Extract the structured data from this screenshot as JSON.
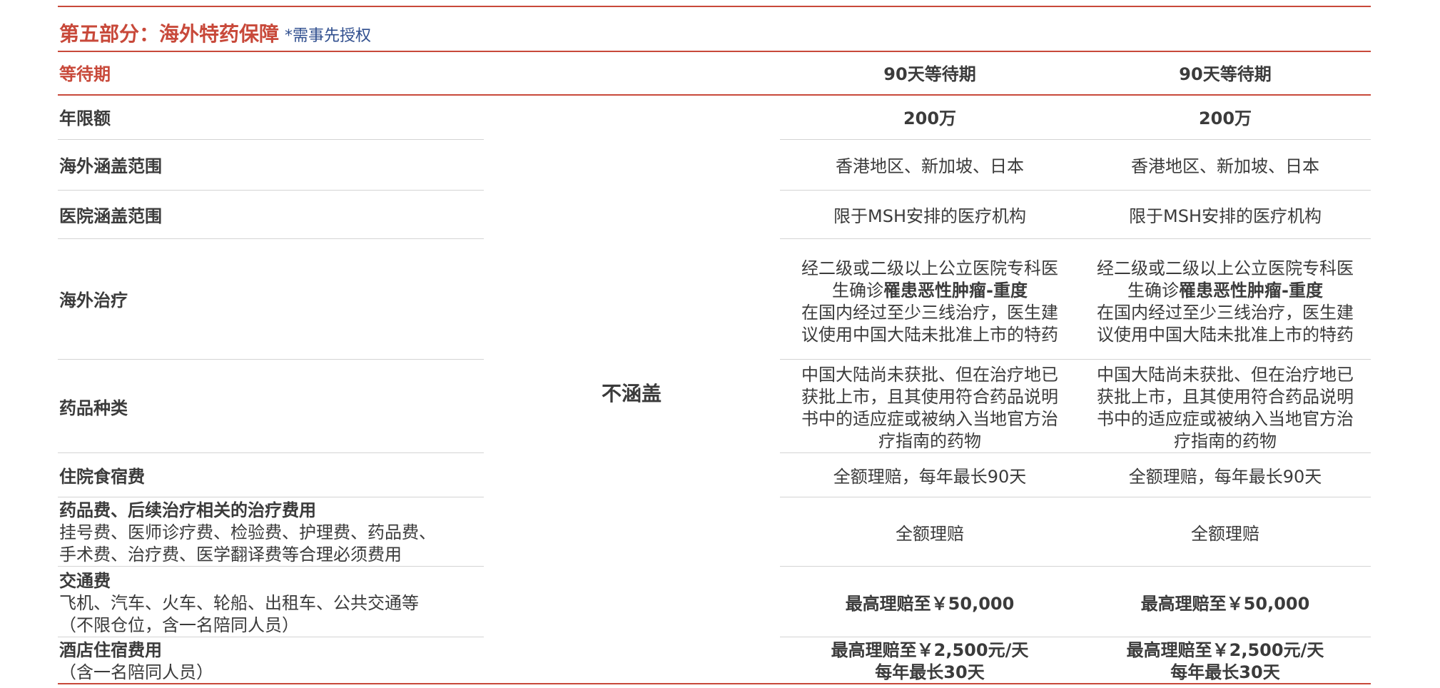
{
  "section": {
    "title": "第五部分：海外特药保障",
    "note": "*需事先授权"
  },
  "not_covered": "不涵盖",
  "rows": {
    "waiting": {
      "label": "等待期",
      "c1": "90天等待期",
      "c2": "90天等待期"
    },
    "annual_limit": {
      "label": "年限额",
      "c1": "200万",
      "c2": "200万"
    },
    "overseas_scope": {
      "label": "海外涵盖范围",
      "c1": "香港地区、新加坡、日本",
      "c2": "香港地区、新加坡、日本"
    },
    "hospital_scope": {
      "label": "医院涵盖范围",
      "c1": "限于MSH安排的医疗机构",
      "c2": "限于MSH安排的医疗机构"
    },
    "overseas_treatment": {
      "label": "海外治疗",
      "line1": "经二级或二级以上公立医院专科医",
      "line2_pre": "生确诊",
      "line2_bold": "罹患恶性肿瘤-重度",
      "line3": "在国内经过至少三线治疗，医生建",
      "line4": "议使用中国大陆未批准上市的特药"
    },
    "drug_type": {
      "label": "药品种类",
      "line1": "中国大陆尚未获批、但在治疗地已",
      "line2": "获批上市，且其使用符合药品说明",
      "line3": "书中的适应症或被纳入当地官方治",
      "line4": "疗指南的药物"
    },
    "inpatient_board": {
      "label": "住院食宿费",
      "c1": "全额理赔，每年最长90天",
      "c2": "全额理赔，每年最长90天"
    },
    "drug_fees": {
      "label_bold": "药品费、后续治疗相关的治疗费用",
      "label_line2": "挂号费、医师诊疗费、检验费、护理费、药品费、",
      "label_line3": "手术费、治疗费、医学翻译费等合理必须费用",
      "c1": "全额理赔",
      "c2": "全额理赔"
    },
    "transport": {
      "label_bold": "交通费",
      "label_line2": "飞机、汽车、火车、轮船、出租车、公共交通等",
      "label_line3": "（不限仓位，含一名陪同人员）",
      "c1": "最高理赔至￥50,000",
      "c2": "最高理赔至￥50,000"
    },
    "hotel": {
      "label_bold": "酒店住宿费用",
      "label_line2": "（含一名陪同人员）",
      "c1_line1": "最高理赔至￥2,500元/天",
      "c1_line2": "每年最长30天",
      "c2_line1": "最高理赔至￥2,500元/天",
      "c2_line2": "每年最长30天"
    }
  }
}
